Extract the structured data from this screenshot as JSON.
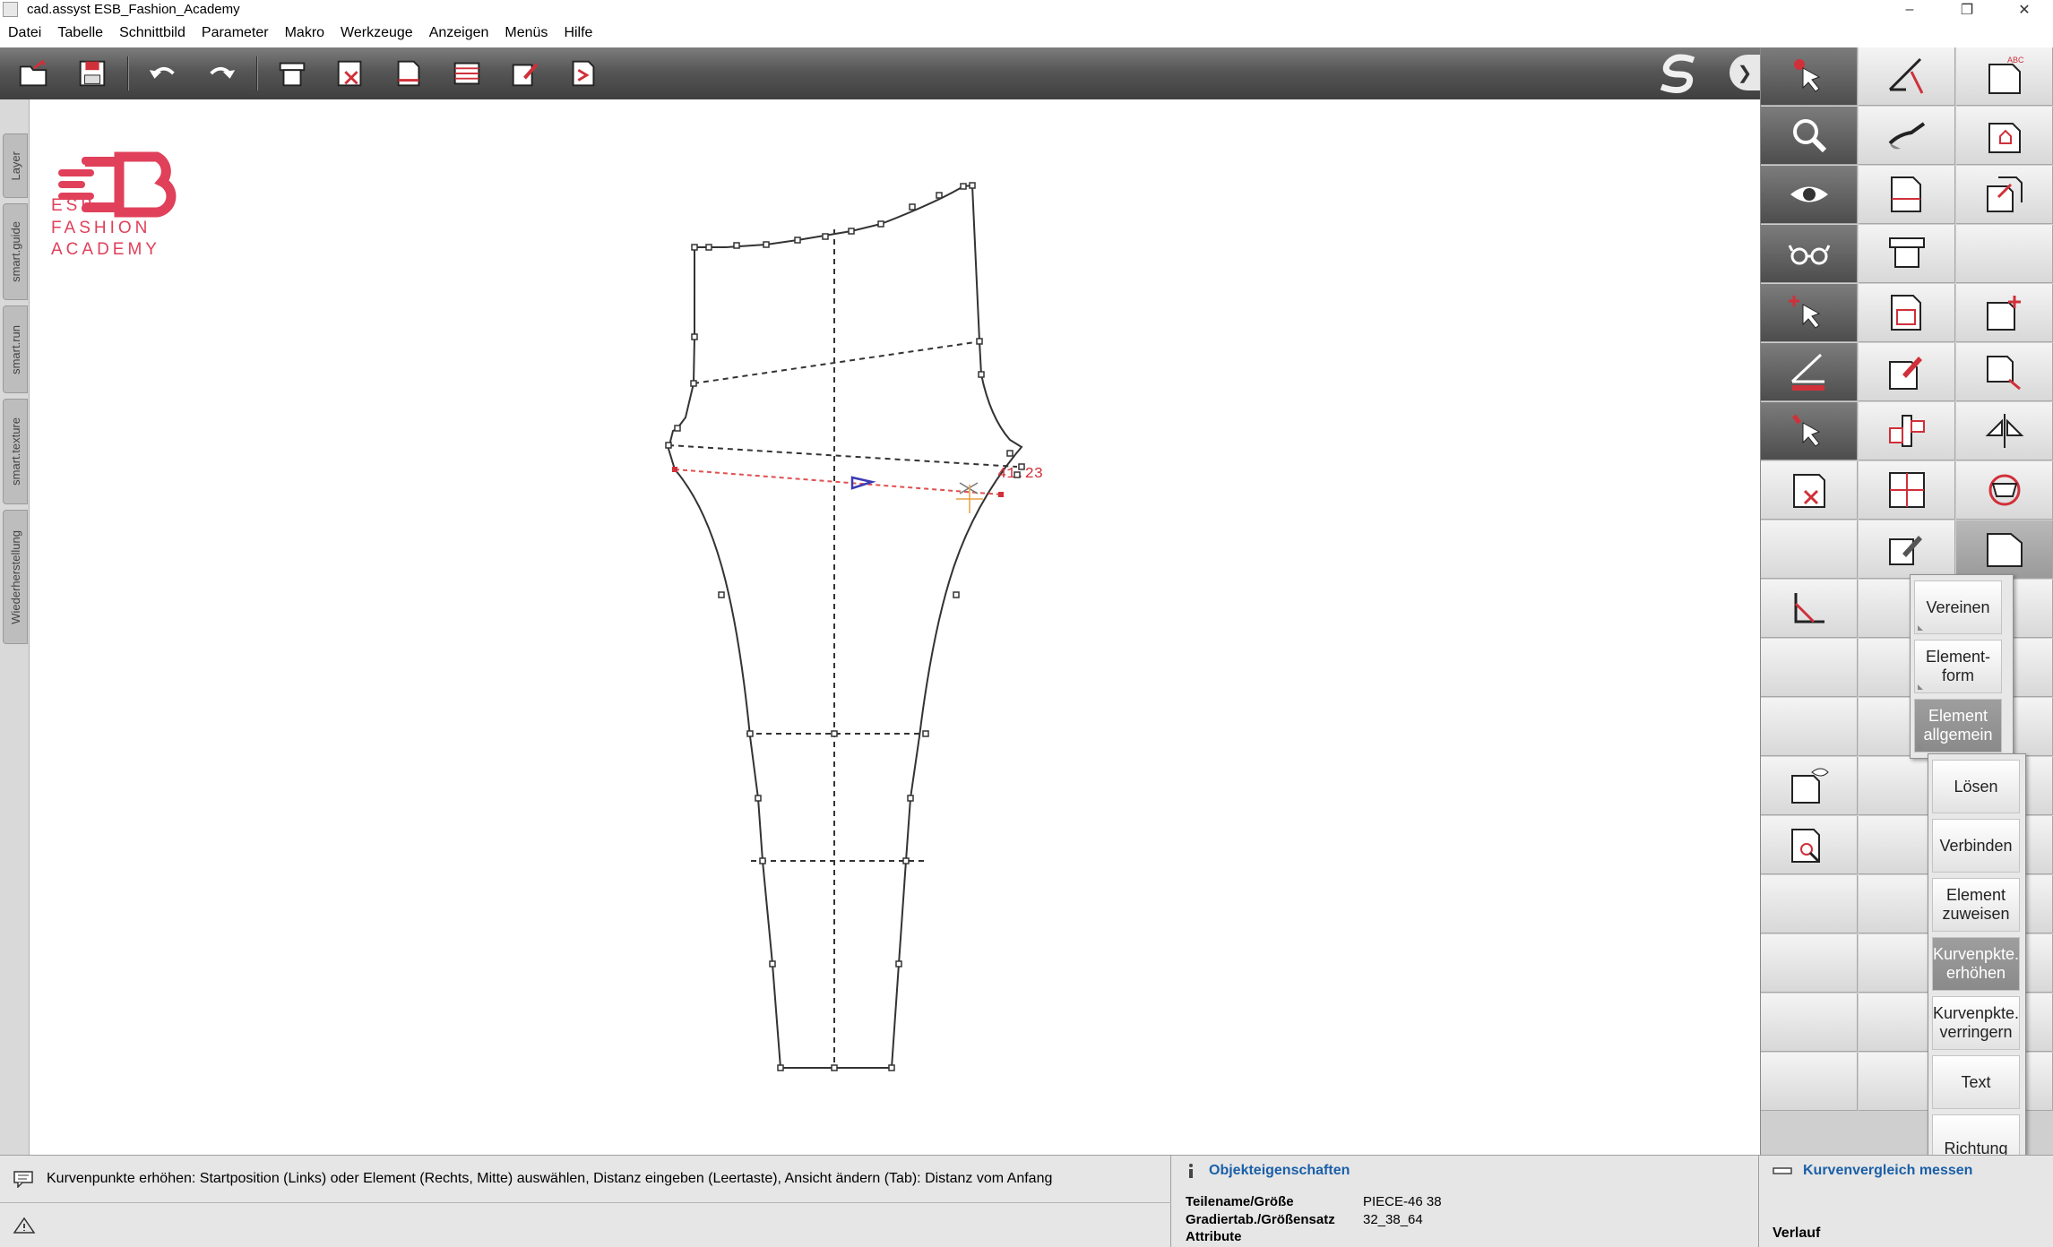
{
  "window": {
    "title": "cad.assyst  ESB_Fashion_Academy",
    "minimize": "–",
    "restore": "❐",
    "close": "✕"
  },
  "menu": [
    "Datei",
    "Tabelle",
    "Schnittbild",
    "Parameter",
    "Makro",
    "Werkzeuge",
    "Anzeigen",
    "Menüs",
    "Hilfe"
  ],
  "toolbar": {
    "icons": [
      "open-icon",
      "save-icon",
      "undo-icon",
      "redo-icon",
      "plot-icon",
      "delete-piece-icon",
      "piece-icon",
      "table-icon",
      "edit-icon",
      "export-icon"
    ],
    "expand_arrow": "❯"
  },
  "left_tabs": [
    "Layer",
    "smart.guide",
    "smart.run",
    "smart.texture",
    "Wiederherstellung"
  ],
  "logo": {
    "line1": "ESB",
    "line2": "FASHION",
    "line3": "ACADEMY",
    "color": "#e0405a"
  },
  "canvas": {
    "measurement": "41.23"
  },
  "popup_primary": {
    "items": [
      "Vereinen",
      "Element-\nform",
      "Element\nallgemein"
    ],
    "active_index": 2
  },
  "popup_secondary": {
    "items": [
      "Lösen",
      "Verbinden",
      "Element\nzuweisen",
      "Kurvenpkte.\nerhöhen",
      "Kurvenpkte.\nverringern",
      "Text",
      "Richtung"
    ],
    "active_index": 3
  },
  "status": {
    "message": "Kurvenpunkte erhöhen: Startposition (Links) oder Element (Rechts, Mitte) auswählen, Distanz eingeben (Leertaste), Ansicht ändern (Tab): Distanz vom Anfang",
    "properties_title": "Objekteigenschaften",
    "props": [
      {
        "key": "Teilename/Größe",
        "value": "PIECE-46 38"
      },
      {
        "key": "Gradiertab./Größensatz",
        "value": "32_38_64"
      },
      {
        "key": "Attribute",
        "value": ""
      }
    ],
    "right_title": "Kurvenvergleich messen",
    "history_label": "Verlauf"
  },
  "colors": {
    "toolbar_dark": "#4d4d4d",
    "accent_red": "#d0303a",
    "link_blue": "#1a5fa8"
  }
}
